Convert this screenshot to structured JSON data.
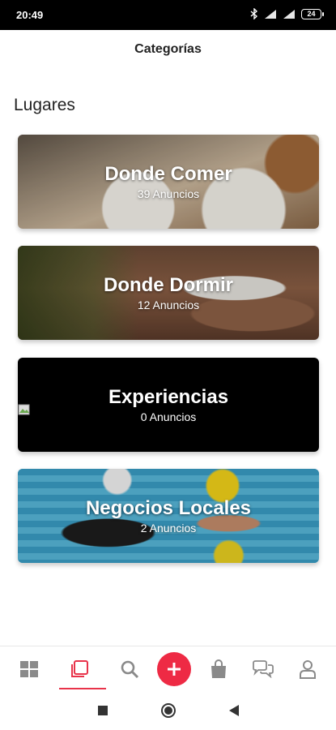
{
  "status_bar": {
    "time": "20:49",
    "battery": "24"
  },
  "header": {
    "title": "Categorías"
  },
  "section": {
    "title": "Lugares"
  },
  "categories": [
    {
      "title": "Donde Comer",
      "count": "39 Anuncios"
    },
    {
      "title": "Donde Dormir",
      "count": "12 Anuncios"
    },
    {
      "title": "Experiencias",
      "count": "0 Anuncios"
    },
    {
      "title": "Negocios Locales",
      "count": "2 Anuncios"
    }
  ],
  "bottom_nav": {
    "active_index": 1,
    "accent_color": "#ee2a44",
    "icons": [
      "grid-icon",
      "categories-icon",
      "search-icon",
      "add-icon",
      "bag-icon",
      "chat-icon",
      "profile-icon"
    ]
  },
  "android_nav": {
    "icons": [
      "recents-icon",
      "home-icon",
      "back-icon"
    ]
  }
}
